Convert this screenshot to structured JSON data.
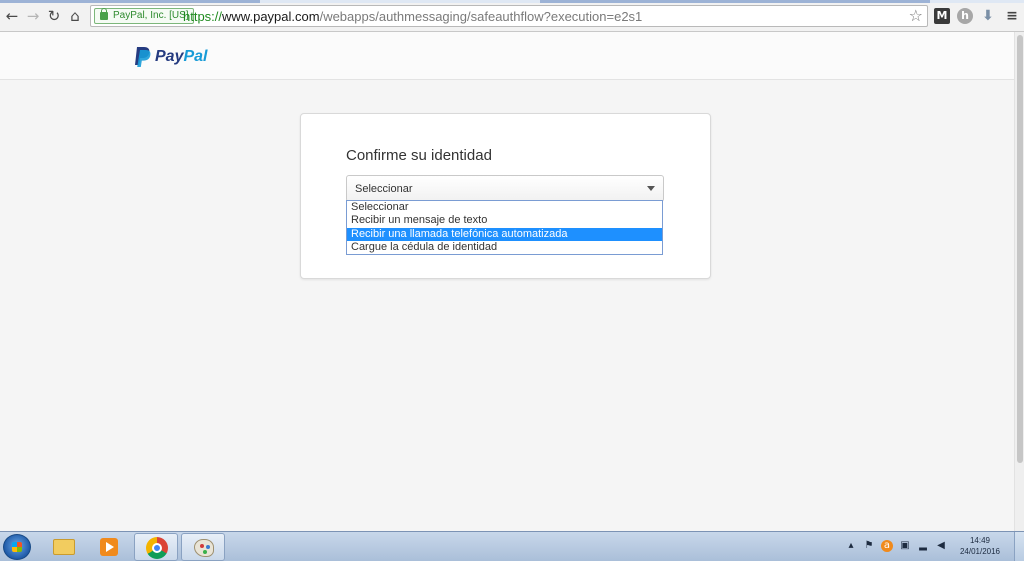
{
  "browser": {
    "ev_badge": "PayPal, Inc. [US]",
    "url_scheme": "https://",
    "url_host": "www.paypal.com",
    "url_path": "/webapps/authmessaging/safeauthflow?execution=e2s1",
    "icons": {
      "back": "back-arrow-icon",
      "forward": "forward-arrow-icon",
      "reload": "reload-icon",
      "home": "home-icon",
      "star": "bookmark-star-icon",
      "menu": "hamburger-menu-icon"
    },
    "ext_m": "M",
    "ext_h": "h"
  },
  "header": {
    "logo_pay": "Pay",
    "logo_pal": "Pal"
  },
  "card": {
    "title": "Confirme su identidad",
    "select_value": "Seleccionar",
    "options": [
      "Seleccionar",
      "Recibir un mensaje de texto",
      "Recibir una llamada telefónica automatizada",
      "Cargue la cédula de identidad"
    ],
    "highlighted_option_index": 2
  },
  "colors": {
    "paypal_dark": "#253b80",
    "paypal_light": "#179bd7",
    "option_highlight": "#1e90ff"
  },
  "taskbar": {
    "time": "14:49",
    "date": "24/01/2016"
  }
}
